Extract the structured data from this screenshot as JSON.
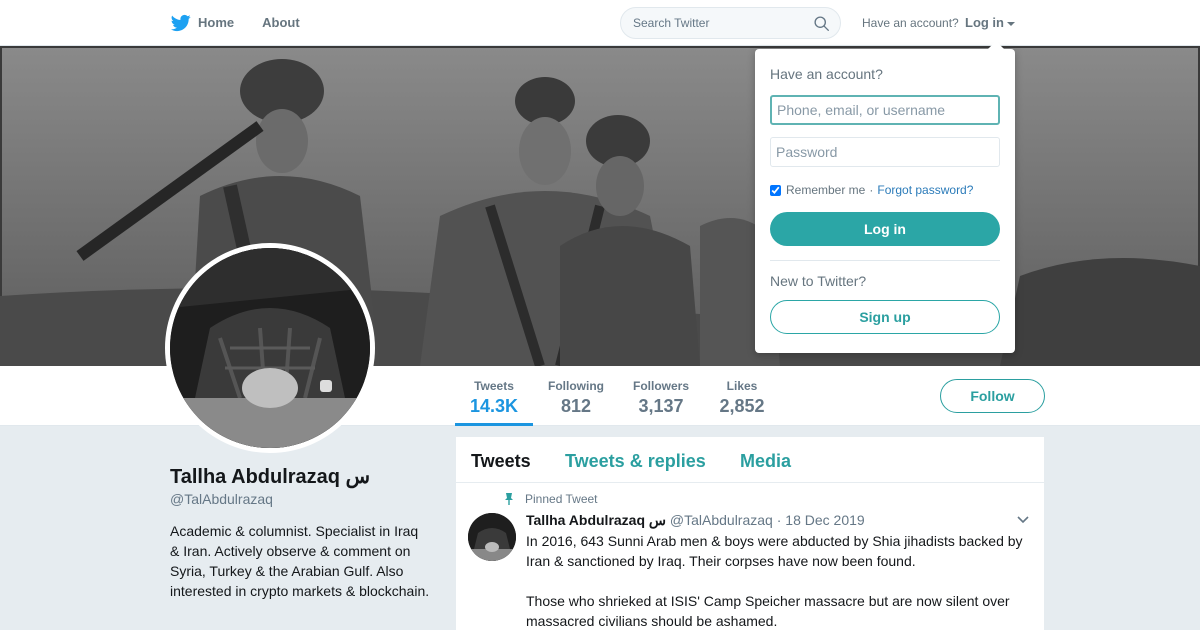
{
  "colors": {
    "accent": "#2b9fa0",
    "link_blue": "#1b95e0",
    "twitter_blue": "#1da1f2"
  },
  "nav": {
    "logo_icon": "twitter-bird-icon",
    "home_label": "Home",
    "about_label": "About",
    "search_placeholder": "Search Twitter",
    "search_icon": "magnifier-icon",
    "have_account": "Have an account?",
    "login_label": "Log in"
  },
  "login_dropdown": {
    "title": "Have an account?",
    "username_placeholder": "Phone, email, or username",
    "password_placeholder": "Password",
    "remember_label": "Remember me",
    "separator": "·",
    "forgot_label": "Forgot password?",
    "login_button": "Log in",
    "new_label": "New to Twitter?",
    "signup_button": "Sign up"
  },
  "profile": {
    "name": "Tallha Abdulrazaq س",
    "handle": "@TalAbdulrazaq",
    "bio": "Academic & columnist. Specialist in Iraq & Iran. Actively observe & comment on Syria, Turkey & the Arabian Gulf. Also interested in crypto markets & blockchain.",
    "stats": [
      {
        "label": "Tweets",
        "value": "14.3K"
      },
      {
        "label": "Following",
        "value": "812"
      },
      {
        "label": "Followers",
        "value": "3,137"
      },
      {
        "label": "Likes",
        "value": "2,852"
      }
    ],
    "follow_button": "Follow"
  },
  "timeline": {
    "tabs": [
      {
        "label": "Tweets"
      },
      {
        "label": "Tweets & replies"
      },
      {
        "label": "Media"
      }
    ],
    "pinned_tweet": {
      "pinned_label": "Pinned Tweet",
      "name": "Tallha Abdulrazaq س",
      "handle": "@TalAbdulrazaq",
      "dot": "·",
      "date": "18 Dec 2019",
      "paragraphs": [
        "In 2016, 643 Sunni Arab men & boys were abducted by Shia jihadists backed by Iran & sanctioned by Iraq. Their corpses have now been found.",
        "Those who shrieked at ISIS' Camp Speicher massacre but are now silent over massacred civilians should be ashamed."
      ]
    }
  }
}
